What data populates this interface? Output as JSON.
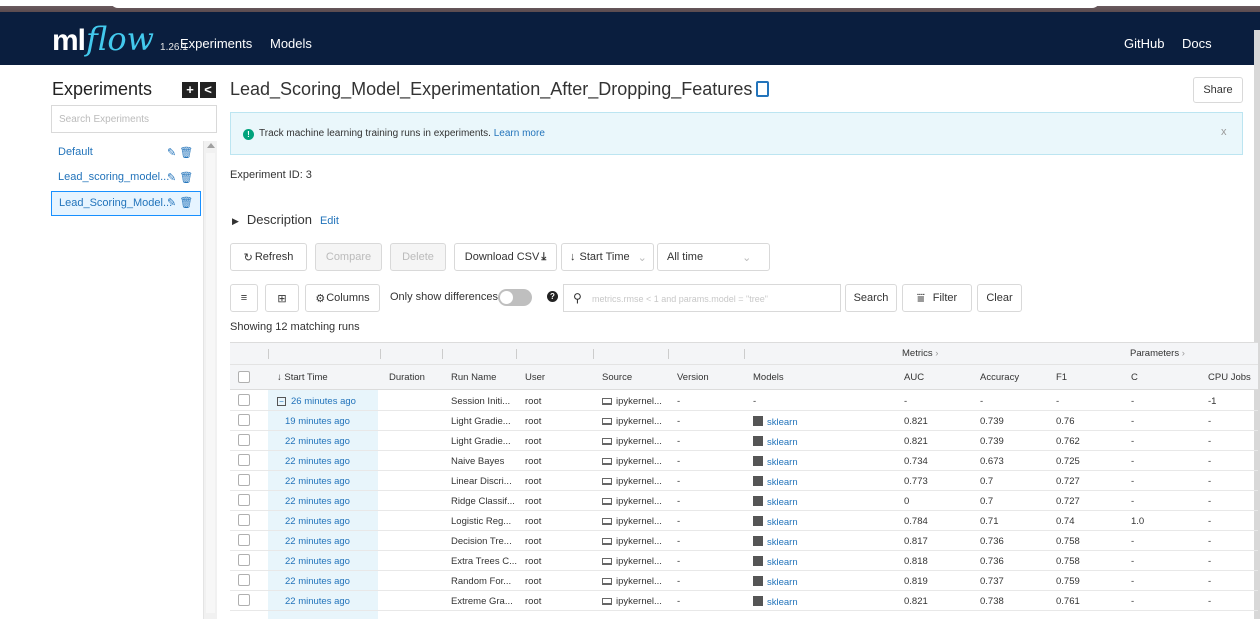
{
  "app": {
    "logo_ml": "ml",
    "logo_flow": "flow",
    "version": "1.26.1"
  },
  "nav": {
    "experiments": "Experiments",
    "models": "Models",
    "github": "GitHub",
    "docs": "Docs"
  },
  "sidebar": {
    "title": "Experiments",
    "add_btn": "+",
    "collapse_btn": "<",
    "search_placeholder": "Search Experiments",
    "items": [
      {
        "label": "Default"
      },
      {
        "label": "Lead_scoring_model..."
      },
      {
        "label": "Lead_Scoring_Model..."
      }
    ]
  },
  "main": {
    "title": "Lead_Scoring_Model_Experimentation_After_Dropping_Features",
    "share": "Share",
    "banner_text": "Track machine learning training runs in experiments.",
    "banner_link": "Learn more",
    "banner_close": "x",
    "experiment_id": "Experiment ID: 3",
    "description": "Description",
    "edit": "Edit"
  },
  "toolbar": {
    "refresh": "Refresh",
    "compare": "Compare",
    "delete": "Delete",
    "download_csv": "Download CSV",
    "sort": "Start Time",
    "time_range": "All time",
    "columns": "Columns",
    "only_show_differences": "Only show differences",
    "search_placeholder": "metrics.rmse < 1 and params.model = \"tree\"",
    "search": "Search",
    "filter": "Filter",
    "clear": "Clear"
  },
  "matching_runs": "Showing 12 matching runs",
  "table": {
    "group_metrics": "Metrics",
    "group_parameters": "Parameters",
    "headers": {
      "start_time": "Start Time",
      "duration": "Duration",
      "run_name": "Run Name",
      "user": "User",
      "source": "Source",
      "version": "Version",
      "models": "Models",
      "auc": "AUC",
      "accuracy": "Accuracy",
      "f1": "F1",
      "c": "C",
      "cpu_jobs": "CPU Jobs"
    },
    "rows": [
      {
        "start": "26 minutes ago",
        "run": "Session Initi...",
        "user": "root",
        "source": "ipykernel...",
        "version": "-",
        "model": "-",
        "auc": "-",
        "acc": "-",
        "f1": "-",
        "c": "-",
        "cpu": "-1"
      },
      {
        "start": "19 minutes ago",
        "run": "Light Gradie...",
        "user": "root",
        "source": "ipykernel...",
        "version": "-",
        "model": "sklearn",
        "auc": "0.821",
        "acc": "0.739",
        "f1": "0.76",
        "c": "-",
        "cpu": "-"
      },
      {
        "start": "22 minutes ago",
        "run": "Light Gradie...",
        "user": "root",
        "source": "ipykernel...",
        "version": "-",
        "model": "sklearn",
        "auc": "0.821",
        "acc": "0.739",
        "f1": "0.762",
        "c": "-",
        "cpu": "-"
      },
      {
        "start": "22 minutes ago",
        "run": "Naive Bayes",
        "user": "root",
        "source": "ipykernel...",
        "version": "-",
        "model": "sklearn",
        "auc": "0.734",
        "acc": "0.673",
        "f1": "0.725",
        "c": "-",
        "cpu": "-"
      },
      {
        "start": "22 minutes ago",
        "run": "Linear Discri...",
        "user": "root",
        "source": "ipykernel...",
        "version": "-",
        "model": "sklearn",
        "auc": "0.773",
        "acc": "0.7",
        "f1": "0.727",
        "c": "-",
        "cpu": "-"
      },
      {
        "start": "22 minutes ago",
        "run": "Ridge Classif...",
        "user": "root",
        "source": "ipykernel...",
        "version": "-",
        "model": "sklearn",
        "auc": "0",
        "acc": "0.7",
        "f1": "0.727",
        "c": "-",
        "cpu": "-"
      },
      {
        "start": "22 minutes ago",
        "run": "Logistic Reg...",
        "user": "root",
        "source": "ipykernel...",
        "version": "-",
        "model": "sklearn",
        "auc": "0.784",
        "acc": "0.71",
        "f1": "0.74",
        "c": "1.0",
        "cpu": "-"
      },
      {
        "start": "22 minutes ago",
        "run": "Decision Tre...",
        "user": "root",
        "source": "ipykernel...",
        "version": "-",
        "model": "sklearn",
        "auc": "0.817",
        "acc": "0.736",
        "f1": "0.758",
        "c": "-",
        "cpu": "-"
      },
      {
        "start": "22 minutes ago",
        "run": "Extra Trees C...",
        "user": "root",
        "source": "ipykernel...",
        "version": "-",
        "model": "sklearn",
        "auc": "0.818",
        "acc": "0.736",
        "f1": "0.758",
        "c": "-",
        "cpu": "-"
      },
      {
        "start": "22 minutes ago",
        "run": "Random For...",
        "user": "root",
        "source": "ipykernel...",
        "version": "-",
        "model": "sklearn",
        "auc": "0.819",
        "acc": "0.737",
        "f1": "0.759",
        "c": "-",
        "cpu": "-"
      },
      {
        "start": "22 minutes ago",
        "run": "Extreme Gra...",
        "user": "root",
        "source": "ipykernel...",
        "version": "-",
        "model": "sklearn",
        "auc": "0.821",
        "acc": "0.738",
        "f1": "0.761",
        "c": "-",
        "cpu": "-"
      }
    ]
  }
}
